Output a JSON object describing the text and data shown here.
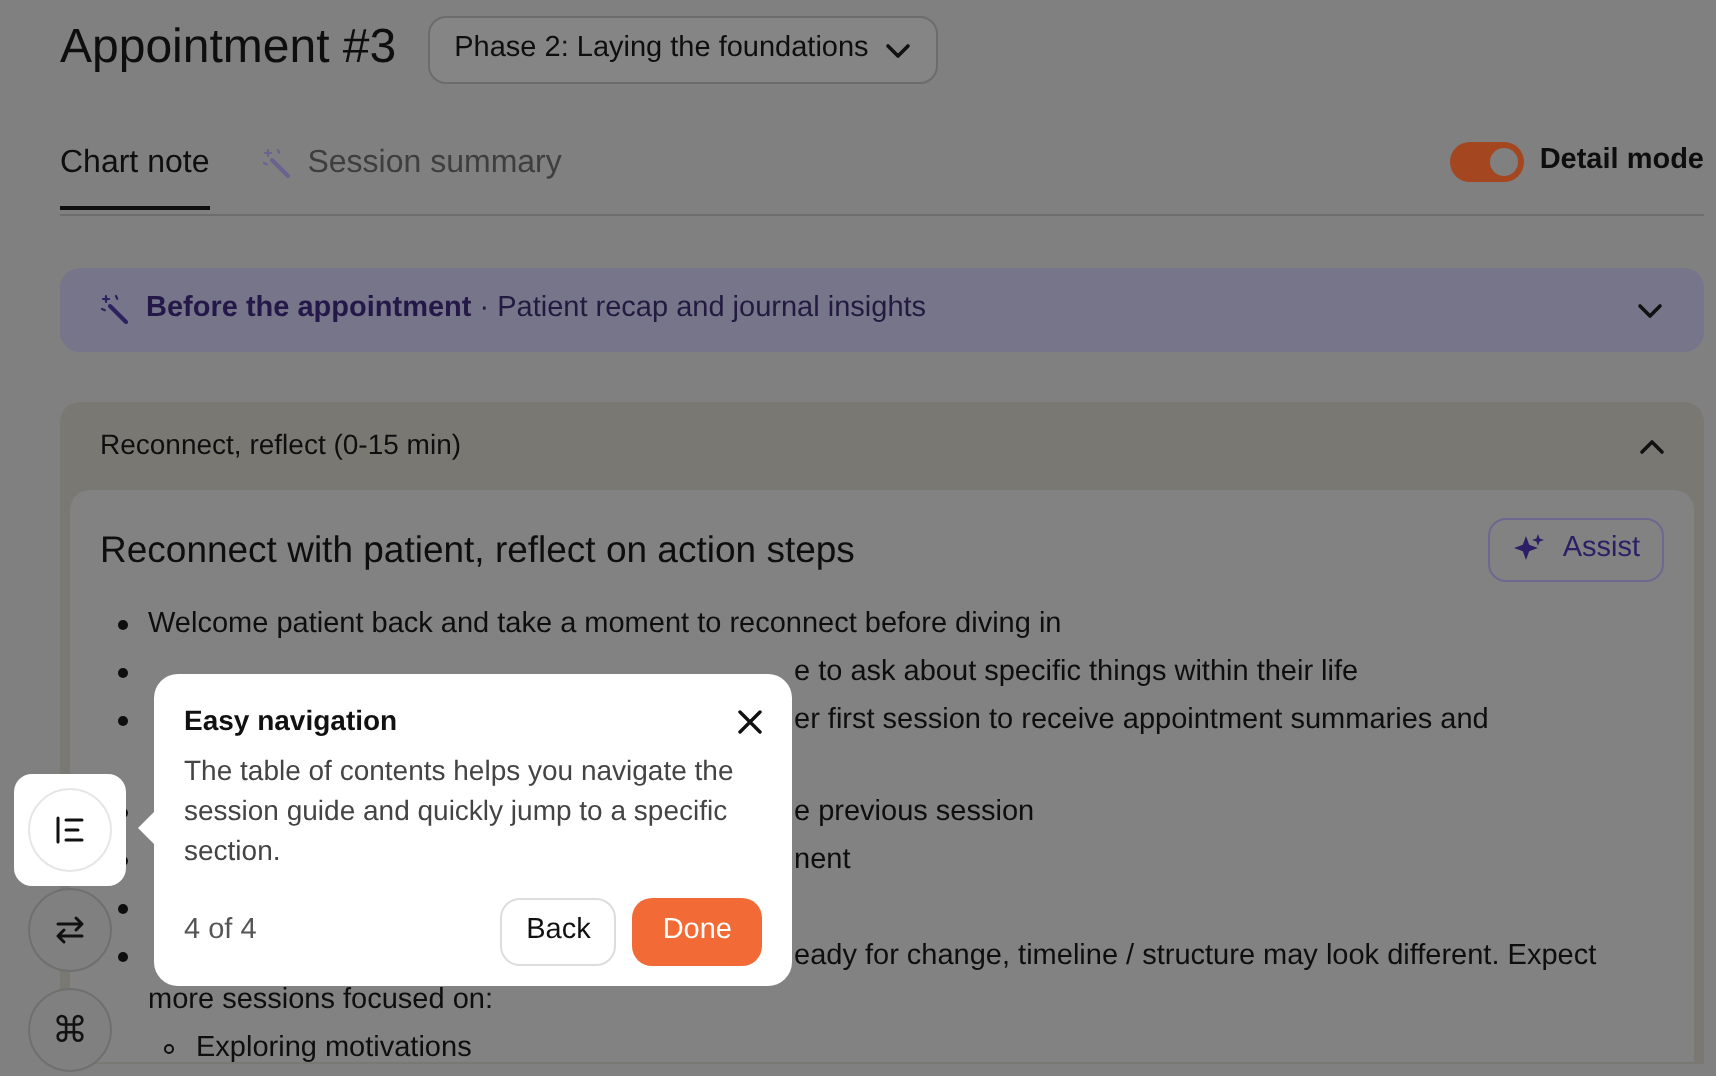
{
  "header": {
    "title": "Appointment #3",
    "phase": "Phase 2: Laying the foundations"
  },
  "tabs": [
    {
      "label": "Chart note",
      "selected": true,
      "kind": "plain"
    },
    {
      "label": "Session summary",
      "selected": false,
      "kind": "magic"
    }
  ],
  "detail_mode": {
    "label": "Detail mode",
    "on": true
  },
  "before_panel": {
    "title": "Before the appointment",
    "subtitle": "· Patient recap and journal insights",
    "expanded": false
  },
  "section": {
    "header": "Reconnect, reflect (0-15 min)",
    "expanded": true,
    "title": "Reconnect with patient, reflect on action steps",
    "assist": "Assist",
    "items": [
      {
        "kind": "bullet",
        "covered": false,
        "text": "Welcome patient back and take a moment to reconnect before diving in"
      },
      {
        "kind": "bullet",
        "covered": true,
        "text": "e to ask about specific things within their life"
      },
      {
        "kind": "bullet",
        "covered": true,
        "text": "er first session to receive appointment summaries and"
      },
      {
        "kind": "continuation",
        "covered": true
      },
      {
        "kind": "bullet",
        "covered": true,
        "text": "e previous session"
      },
      {
        "kind": "bullet",
        "covered": true,
        "text": "nent"
      },
      {
        "kind": "bullet",
        "covered": true
      },
      {
        "kind": "bullet",
        "covered": true,
        "text": "eady for change, timeline / structure may look different. Expect"
      },
      {
        "kind": "continuation",
        "covered": false,
        "text": "more sessions focused on:"
      },
      {
        "kind": "sub",
        "covered": false,
        "text": "Exploring motivations"
      }
    ]
  },
  "side_tools": [
    {
      "kind": "toc",
      "selected": true
    },
    {
      "kind": "swap",
      "selected": false
    },
    {
      "kind": "command",
      "selected": false,
      "glyph": "⌘"
    }
  ],
  "tour": {
    "title": "Easy navigation",
    "body": "The table of contents helps you navigate the session guide and quickly jump to a specific section.",
    "step": "4 of 4",
    "back": "Back",
    "done": "Done"
  }
}
